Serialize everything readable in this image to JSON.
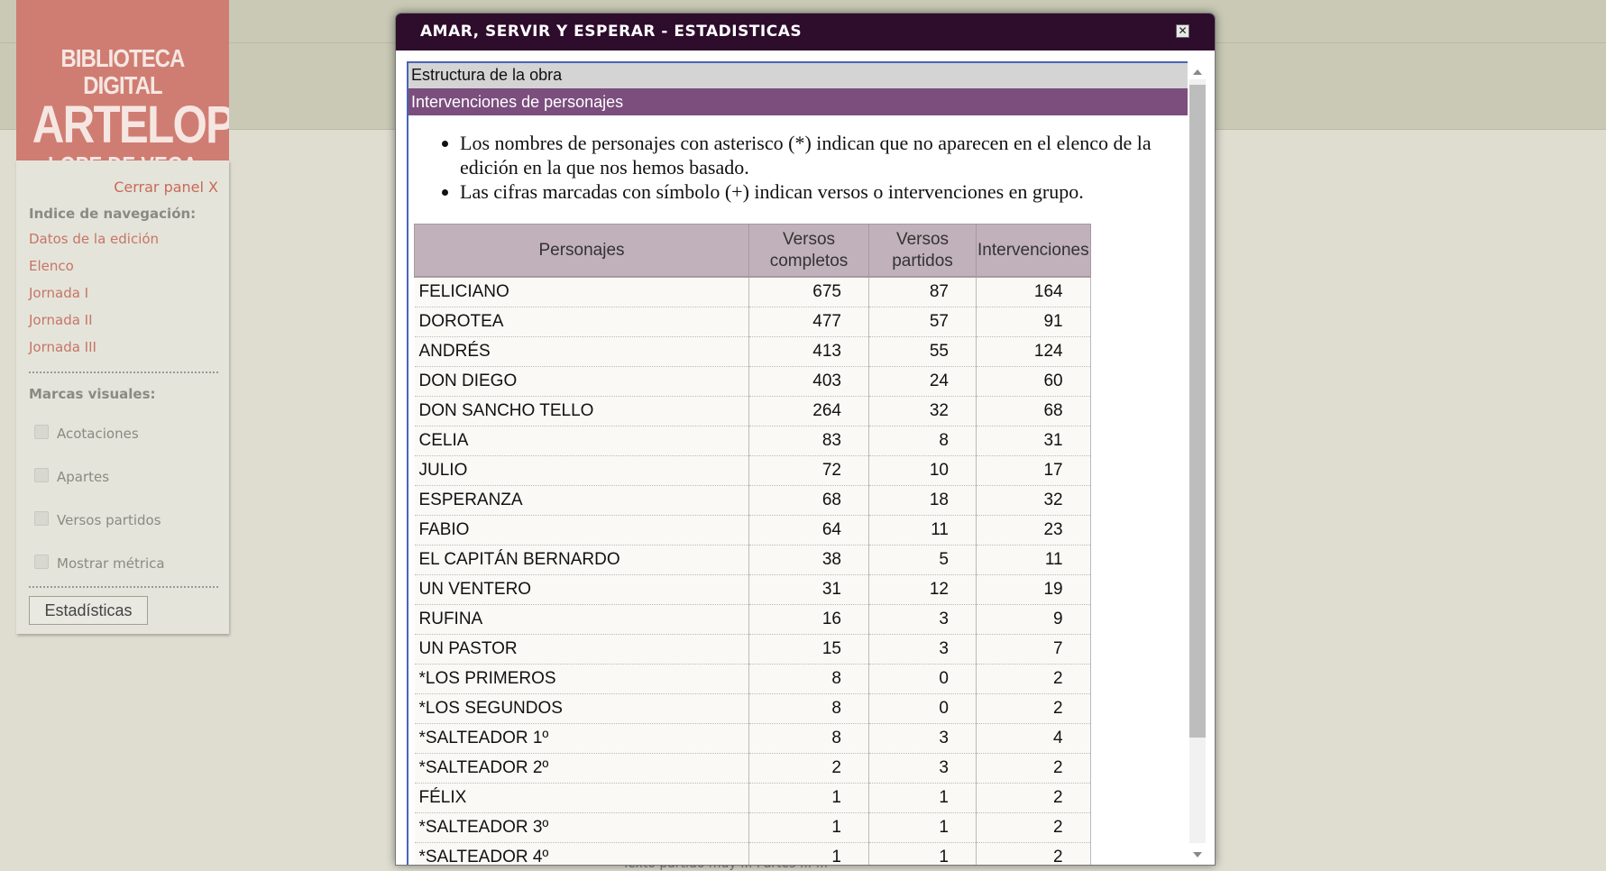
{
  "logo": {
    "line1": "BIBLIOTECA DIGITAL",
    "line2": "ARTELOPE",
    "line3": "LOPE DE VEGA"
  },
  "sidebar": {
    "close_label": "Cerrar panel X",
    "nav_heading": "Indice de navegación:",
    "nav_items": [
      "Datos de la edición",
      "Elenco",
      "Jornada I",
      "Jornada II",
      "Jornada III"
    ],
    "marks_heading": "Marcas visuales:",
    "checkboxes": [
      "Acotaciones",
      "Apartes",
      "Versos partidos",
      "Mostrar métrica"
    ],
    "stats_button": "Estadísticas"
  },
  "footer_text": "Texto partido muy ... Partes ... ...",
  "dialog": {
    "title": "AMAR, SERVIR Y ESPERAR - ESTADISTICAS",
    "close_icon": "close-icon",
    "accordion": [
      "Estructura de la obra",
      "Intervenciones de personajes"
    ],
    "notes": [
      "Los nombres de personajes con asterisco (*) indican que no aparecen en el elenco de la edición en la que nos hemos basado.",
      "Las cifras marcadas con símbolo (+) indican versos o intervenciones en grupo."
    ],
    "table": {
      "headers": [
        "Personajes",
        "Versos completos",
        "Versos partidos",
        "Intervenciones"
      ],
      "rows": [
        [
          "FELICIANO",
          "675",
          "87",
          "164"
        ],
        [
          "DOROTEA",
          "477",
          "57",
          "91"
        ],
        [
          "ANDRÉS",
          "413",
          "55",
          "124"
        ],
        [
          "DON DIEGO",
          "403",
          "24",
          "60"
        ],
        [
          "DON SANCHO TELLO",
          "264",
          "32",
          "68"
        ],
        [
          "CELIA",
          "83",
          "8",
          "31"
        ],
        [
          "JULIO",
          "72",
          "10",
          "17"
        ],
        [
          "ESPERANZA",
          "68",
          "18",
          "32"
        ],
        [
          "FABIO",
          "64",
          "11",
          "23"
        ],
        [
          "EL CAPITÁN BERNARDO",
          "38",
          "5",
          "11"
        ],
        [
          "UN VENTERO",
          "31",
          "12",
          "19"
        ],
        [
          "RUFINA",
          "16",
          "3",
          "9"
        ],
        [
          "UN PASTOR",
          "15",
          "3",
          "7"
        ],
        [
          "*LOS PRIMEROS",
          "8",
          "0",
          "2"
        ],
        [
          "*LOS SEGUNDOS",
          "8",
          "0",
          "2"
        ],
        [
          "*SALTEADOR 1º",
          "8",
          "3",
          "4"
        ],
        [
          "*SALTEADOR 2º",
          "2",
          "3",
          "2"
        ],
        [
          "FÉLIX",
          "1",
          "1",
          "2"
        ],
        [
          "*SALTEADOR 3º",
          "1",
          "1",
          "2"
        ],
        [
          "*SALTEADOR 4º",
          "1",
          "1",
          "2"
        ]
      ]
    }
  }
}
